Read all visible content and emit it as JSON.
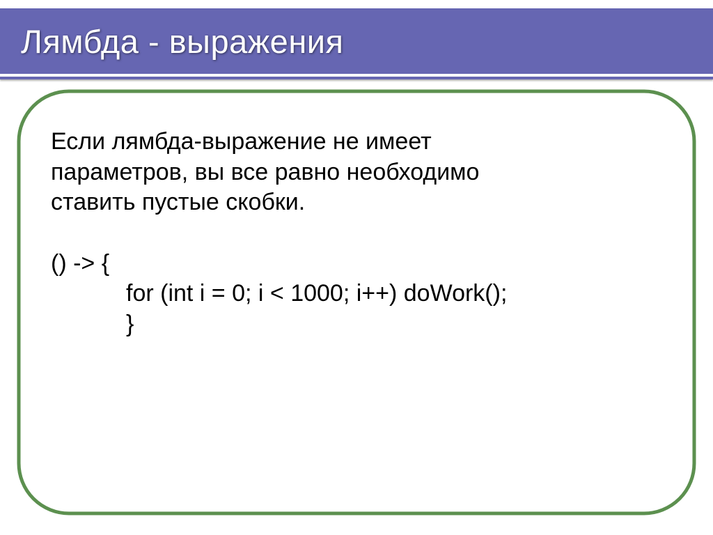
{
  "title": "Лямбда - выражения",
  "body": {
    "p1_l1": "Если лямбда-выражение не имеет",
    "p1_l2": "параметров, вы все равно необходимо",
    "p1_l3": "ставить пустые скобки.",
    "code_l1": "() -> {",
    "code_l2_indented": "for (int i = 0; i < 1000; i++) doWork();",
    "code_l3_indented": "}"
  },
  "colors": {
    "accent": "#6666b2",
    "frame": "#5c904f"
  }
}
